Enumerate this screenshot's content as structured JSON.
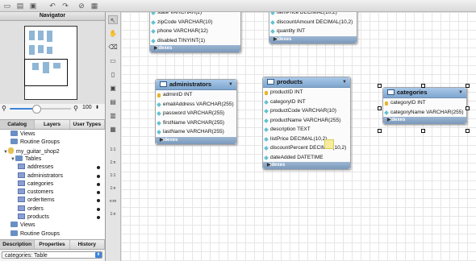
{
  "navigator": {
    "title": "Navigator",
    "zoom_value": "100"
  },
  "left_tabs": [
    "Catalog",
    "Layers",
    "User Types"
  ],
  "catalog_tree": [
    {
      "label": "Views",
      "kind": "folder",
      "indent": 1
    },
    {
      "label": "Routine Groups",
      "kind": "folder",
      "indent": 1
    },
    {
      "label": "my_guitar_shop2",
      "kind": "db",
      "indent": 0,
      "expanded": true
    },
    {
      "label": "Tables",
      "kind": "folder",
      "indent": 1,
      "expanded": true
    },
    {
      "label": "addresses",
      "kind": "table",
      "indent": 2
    },
    {
      "label": "administrators",
      "kind": "table",
      "indent": 2
    },
    {
      "label": "categories",
      "kind": "table",
      "indent": 2
    },
    {
      "label": "customers",
      "kind": "table",
      "indent": 2
    },
    {
      "label": "orderItems",
      "kind": "table",
      "indent": 2
    },
    {
      "label": "orders",
      "kind": "table",
      "indent": 2
    },
    {
      "label": "products",
      "kind": "table",
      "indent": 2
    },
    {
      "label": "Views",
      "kind": "folder",
      "indent": 1
    },
    {
      "label": "Routine Groups",
      "kind": "folder",
      "indent": 1
    }
  ],
  "bottom_tabs": [
    "Description",
    "Properties",
    "History"
  ],
  "description_select": "categories: Table",
  "palette_labels": [
    "1:1",
    "1:n",
    "1:1",
    "1:n",
    "n:m",
    "1:n"
  ],
  "entities": {
    "customers_partial": {
      "rows": [
        "state VARCHAR(2)",
        "zipCode VARCHAR(10)",
        "phone VARCHAR(12)",
        "disabled TINYINT(1)"
      ],
      "footer": "Indexes"
    },
    "orderitems_partial": {
      "rows": [
        "itemPrice DECIMAL(10,2)",
        "discountAmount DECIMAL(10,2)",
        "quantity INT"
      ],
      "footer": "Indexes"
    },
    "administrators": {
      "title": "administrators",
      "rows": [
        "adminID INT",
        "emailAddress VARCHAR(255)",
        "password VARCHAR(255)",
        "firstName VARCHAR(255)",
        "lastName VARCHAR(255)"
      ],
      "footer": "Indexes"
    },
    "products": {
      "title": "products",
      "rows": [
        "productID INT",
        "categoryID INT",
        "productCode VARCHAR(10)",
        "productName VARCHAR(255)",
        "description TEXT",
        "listPrice DECIMAL(10,2)",
        "discountPercent DECIMAL(10,2)",
        "dateAdded DATETIME"
      ],
      "footer": "Indexes"
    },
    "categories": {
      "title": "categories",
      "rows": [
        "categoryID INT",
        "categoryName VARCHAR(255)"
      ],
      "footer": "Indexes"
    }
  }
}
